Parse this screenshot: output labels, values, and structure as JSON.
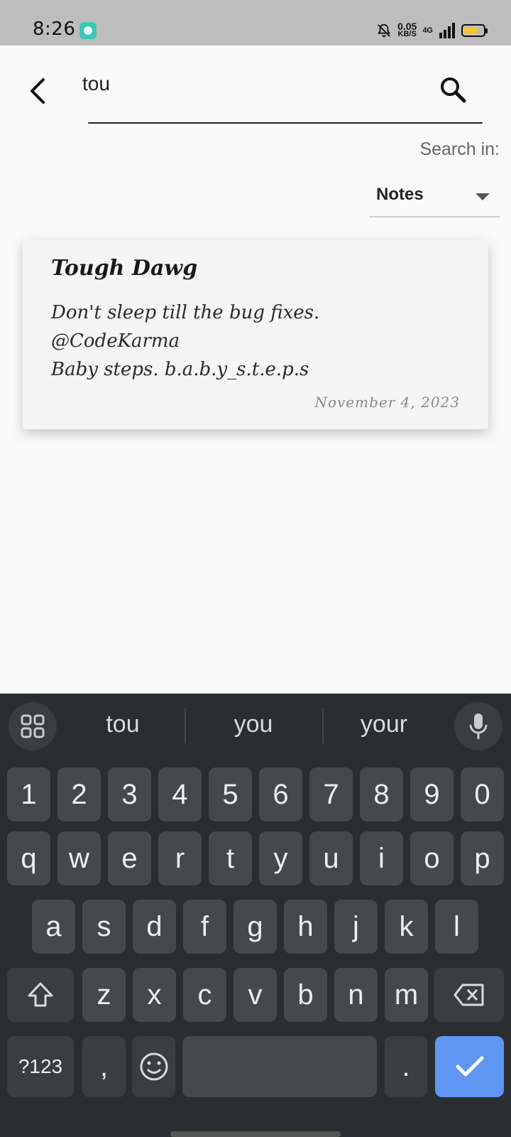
{
  "status_bar": {
    "time": "8:26",
    "app_icon": "app-notification-icon",
    "speed_value": "0.05",
    "speed_unit": "KB/S",
    "network": "4G",
    "icons": [
      "mute-bell-icon",
      "signal-icon",
      "battery-icon"
    ],
    "battery_level": 0.75,
    "battery_color": "#f7c62b"
  },
  "search": {
    "query": "tou",
    "back_icon": "back-arrow-icon",
    "search_icon": "search-icon"
  },
  "filter": {
    "label": "Search in:",
    "selected": "Notes"
  },
  "results": [
    {
      "title": "Tough Dawg",
      "body_lines": [
        "Don't sleep till the bug fixes.",
        "@CodeKarma",
        "Baby steps. b.a.b.y_s.t.e.p.s"
      ],
      "date": "November 4, 2023"
    }
  ],
  "keyboard": {
    "suggestions": [
      "tou",
      "you",
      "your"
    ],
    "row_numbers": [
      "1",
      "2",
      "3",
      "4",
      "5",
      "6",
      "7",
      "8",
      "9",
      "0"
    ],
    "row_top": [
      "q",
      "w",
      "e",
      "r",
      "t",
      "y",
      "u",
      "i",
      "o",
      "p"
    ],
    "row_middle": [
      "a",
      "s",
      "d",
      "f",
      "g",
      "h",
      "j",
      "k",
      "l"
    ],
    "row_bottom": [
      "z",
      "x",
      "c",
      "v",
      "b",
      "n",
      "m"
    ],
    "symbols_label": "?123",
    "comma": ",",
    "period": ".",
    "accent_color": "#5f96f3"
  }
}
